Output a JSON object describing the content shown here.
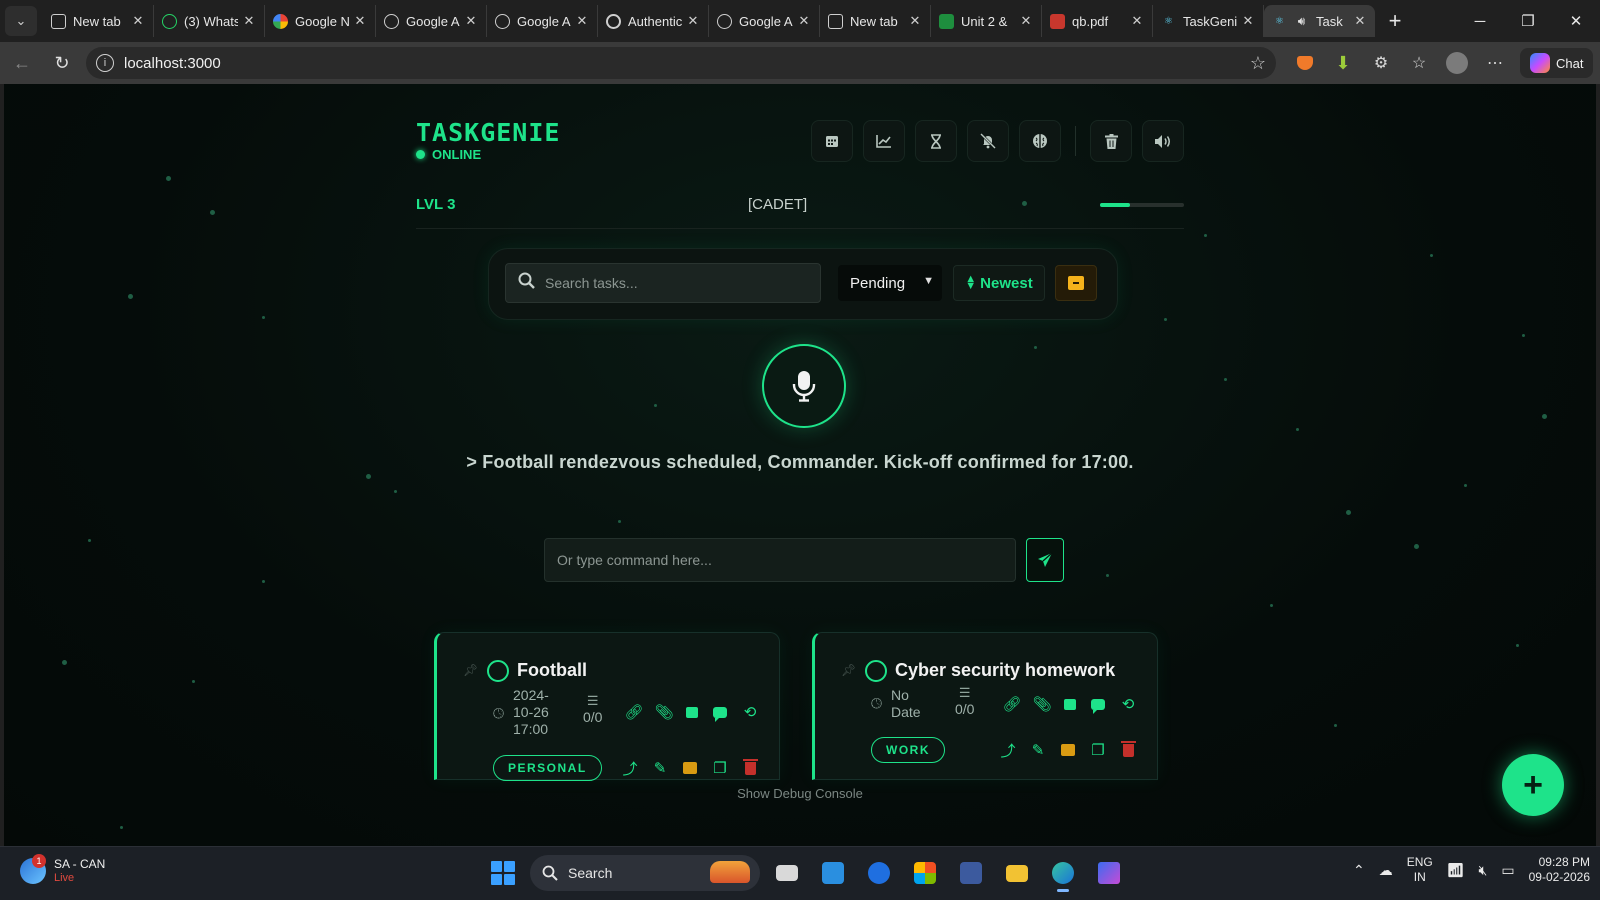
{
  "browser": {
    "tabs": [
      {
        "title": "New tab",
        "icon": "page-icon",
        "active": false
      },
      {
        "title": "(3) Whats",
        "icon": "whatsapp-icon",
        "active": false
      },
      {
        "title": "Google N",
        "icon": "google-colors-icon",
        "active": false
      },
      {
        "title": "Google A",
        "icon": "globe-icon",
        "active": false
      },
      {
        "title": "Google A",
        "icon": "globe-icon",
        "active": false
      },
      {
        "title": "Authentic",
        "icon": "g-icon",
        "active": false
      },
      {
        "title": "Google A",
        "icon": "globe-icon",
        "active": false
      },
      {
        "title": "New tab",
        "icon": "page-icon",
        "active": false
      },
      {
        "title": "Unit 2 &",
        "icon": "classroom-icon",
        "active": false
      },
      {
        "title": "qb.pdf",
        "icon": "pdf-icon",
        "active": false
      },
      {
        "title": "TaskGenie",
        "icon": "react-icon",
        "active": false
      },
      {
        "title": "Task",
        "icon": "react-icon",
        "active": true
      }
    ],
    "url": "localhost:3000",
    "chat_label": "Chat"
  },
  "app": {
    "title": "TASKGENIE",
    "status": "ONLINE",
    "level": "LVL 3",
    "rank": "[CADET]",
    "xp_fraction": 0.36,
    "accent": "#1ee38a",
    "header_icons": [
      "calendar-icon",
      "chart-icon",
      "hourglass-icon",
      "bell-off-icon",
      "brain-icon",
      "trash-icon",
      "volume-icon"
    ],
    "search": {
      "placeholder": "Search tasks..."
    },
    "filter": {
      "value": "Pending"
    },
    "sort": {
      "label": "Newest"
    },
    "voice_message": "> Football rendezvous scheduled, Commander. Kick-off confirmed for 17:00.",
    "command": {
      "placeholder": "Or type command here..."
    },
    "debug_link": "Show Debug Console",
    "tasks": [
      {
        "title": "Football",
        "date_lines": [
          "2024-",
          "10-26",
          "17:00"
        ],
        "subtasks": "0/0",
        "tag": "PERSONAL"
      },
      {
        "title": "Cyber security homework",
        "date_lines": [
          "No",
          "Date"
        ],
        "subtasks": "0/0",
        "tag": "WORK"
      }
    ]
  },
  "taskbar": {
    "weather_title": "SA - CAN",
    "weather_sub": "Live",
    "weather_badge": "1",
    "search_label": "Search",
    "lang_line1": "ENG",
    "lang_line2": "IN",
    "time": "09:28 PM",
    "date": "09-02-2026"
  }
}
